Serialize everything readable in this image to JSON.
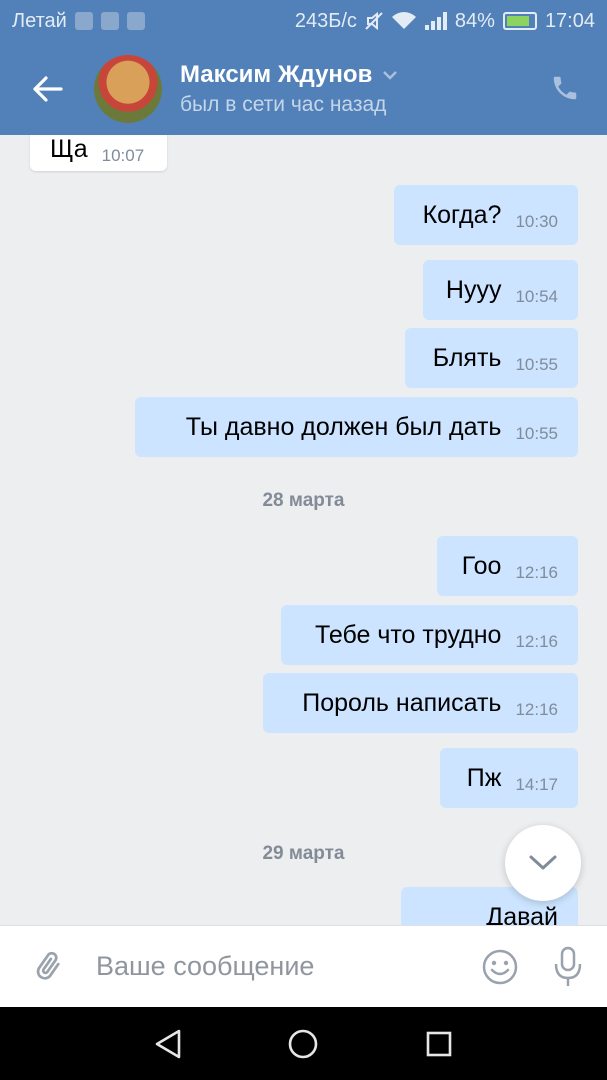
{
  "status_bar": {
    "carrier": "Летай",
    "speed": "243Б/с",
    "battery": "84%",
    "time": "17:04"
  },
  "header": {
    "contact_name": "Максим Ждунов",
    "contact_status": "был в сети час назад"
  },
  "messages": [
    {
      "text": "Ща",
      "time": "10:07",
      "direction": "in"
    },
    {
      "text": "Когда?",
      "time": "10:30",
      "direction": "out"
    },
    {
      "text": "Нууу",
      "time": "10:54",
      "direction": "out"
    },
    {
      "text": "Блять",
      "time": "10:55",
      "direction": "out"
    },
    {
      "text": "Ты давно должен был дать",
      "time": "10:55",
      "direction": "out"
    },
    {
      "text": "Гоо",
      "time": "12:16",
      "direction": "out"
    },
    {
      "text": "Тебе что трудно",
      "time": "12:16",
      "direction": "out"
    },
    {
      "text": "Пороль написать",
      "time": "12:16",
      "direction": "out"
    },
    {
      "text": "Пж",
      "time": "14:17",
      "direction": "out"
    },
    {
      "text": "Давай",
      "time": "",
      "direction": "out"
    }
  ],
  "date_separators": [
    "28 марта",
    "29 марта"
  ],
  "composer": {
    "placeholder": "Ваше сообщение"
  },
  "colors": {
    "header_bg": "#5181b8",
    "chat_bg": "#edeef0",
    "outgoing_bubble": "#cce4ff",
    "incoming_bubble": "#ffffff"
  }
}
